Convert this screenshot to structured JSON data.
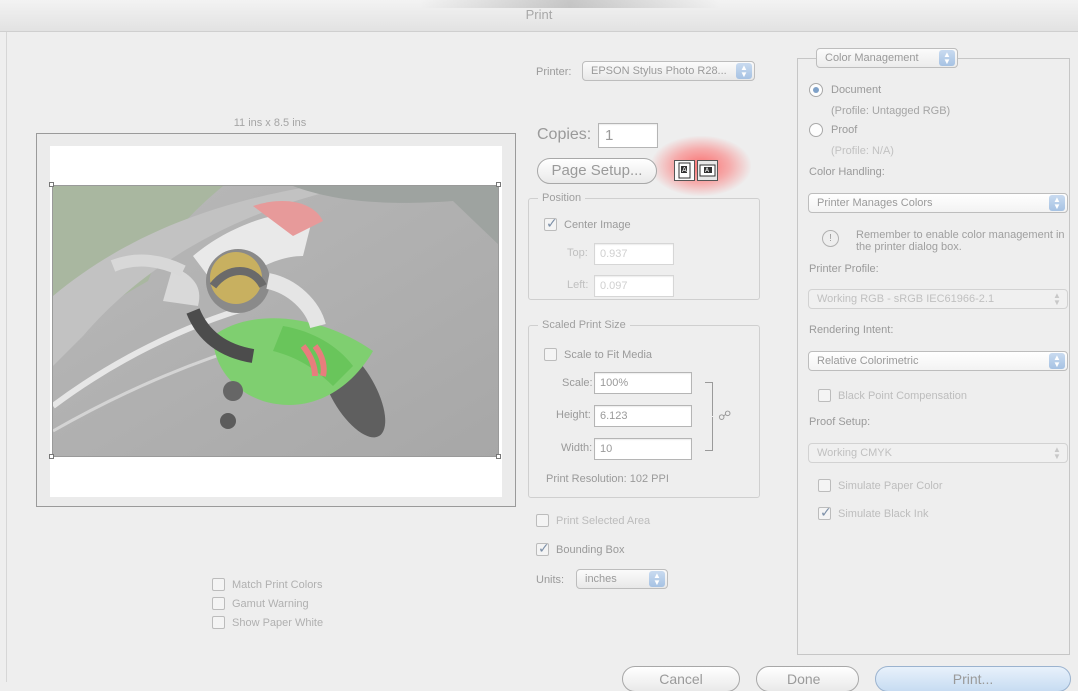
{
  "window": {
    "title": "Print"
  },
  "preview": {
    "paper_size": "11 ins x 8.5 ins",
    "options": [
      {
        "label": "Match Print Colors",
        "checked": false
      },
      {
        "label": "Gamut Warning",
        "checked": false
      },
      {
        "label": "Show Paper White",
        "checked": false
      }
    ]
  },
  "printer": {
    "label": "Printer:",
    "value": "EPSON Stylus Photo R28..."
  },
  "copies": {
    "label": "Copies:",
    "value": "1"
  },
  "page_setup": {
    "label": "Page Setup..."
  },
  "position": {
    "title": "Position",
    "center_image": {
      "label": "Center Image",
      "checked": true
    },
    "top": {
      "label": "Top:",
      "value": "0.937"
    },
    "left": {
      "label": "Left:",
      "value": "0.097"
    }
  },
  "scaled": {
    "title": "Scaled Print Size",
    "scale_to_fit": {
      "label": "Scale to Fit Media",
      "checked": false
    },
    "scale": {
      "label": "Scale:",
      "value": "100%"
    },
    "height": {
      "label": "Height:",
      "value": "6.123"
    },
    "width": {
      "label": "Width:",
      "value": "10"
    },
    "resolution": "Print Resolution: 102 PPI"
  },
  "print_selected_area": {
    "label": "Print Selected Area",
    "checked": false
  },
  "bounding_box": {
    "label": "Bounding Box",
    "checked": true
  },
  "units": {
    "label": "Units:",
    "value": "inches"
  },
  "color": {
    "section_popup": "Color Management",
    "document": {
      "label": "Document",
      "profile": "(Profile: Untagged RGB)",
      "selected": true
    },
    "proof": {
      "label": "Proof",
      "profile": "(Profile: N/A)",
      "selected": false
    },
    "color_handling_label": "Color Handling:",
    "color_handling_value": "Printer Manages Colors",
    "reminder": "Remember to enable color management in the printer dialog box.",
    "printer_profile_label": "Printer Profile:",
    "printer_profile_value": "Working RGB - sRGB IEC61966-2.1",
    "rendering_intent_label": "Rendering Intent:",
    "rendering_intent_value": "Relative Colorimetric",
    "black_point": {
      "label": "Black Point Compensation",
      "checked": false
    },
    "proof_setup_label": "Proof Setup:",
    "proof_setup_value": "Working CMYK",
    "simulate_paper": {
      "label": "Simulate Paper Color",
      "checked": false
    },
    "simulate_ink": {
      "label": "Simulate Black Ink",
      "checked": true
    }
  },
  "buttons": {
    "cancel": "Cancel",
    "done": "Done",
    "print": "Print..."
  }
}
